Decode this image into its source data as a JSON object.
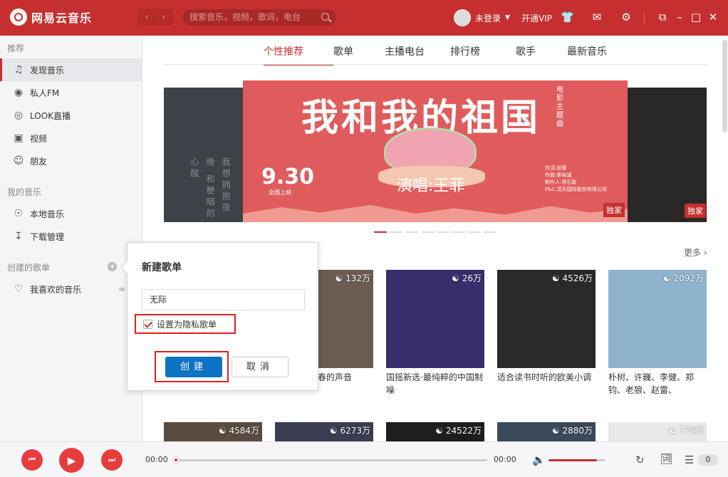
{
  "app": {
    "name": "网易云音乐",
    "search_placeholder": "搜索音乐，视频，歌词，电台",
    "user_label": "未登录",
    "vip_label": "开通VIP"
  },
  "sidebar": {
    "heading_recommend": "推荐",
    "recommend_items": [
      "发现音乐",
      "私人FM",
      "LOOK直播",
      "视频",
      "朋友"
    ],
    "heading_my_music": "我的音乐",
    "my_music_items": [
      "本地音乐",
      "下载管理"
    ],
    "heading_created": "创建的歌单",
    "playlists": [
      "我喜欢的音乐"
    ]
  },
  "tabs": [
    "个性推荐",
    "歌单",
    "主播电台",
    "排行榜",
    "歌手",
    "最新音乐"
  ],
  "banner": {
    "title": "我和我的祖国",
    "date": "9.30",
    "date_sub": "全国上映",
    "singer": "演唱:王菲",
    "vertical_text": "电影主题曲",
    "credits": [
      "作词:张藜",
      "作曲:秦咏诚",
      "制作人:常石磊",
      "P&C:觅乐国际股份有限公司"
    ],
    "badge": "独家",
    "left_poem": "我想拥抱夜晚 和梗咽的心酸"
  },
  "more_label": "更多",
  "cards_row1": [
    {
      "count": "132万",
      "title": "那些关于青春的声音",
      "color": "#6b5b52"
    },
    {
      "count": "26万",
      "title": "国摇新选·最纯粹的中国制噪",
      "color": "#3a2d6d"
    },
    {
      "count": "4526万",
      "title": "适合读书时听的欧美小调",
      "color": "#2a2a2a"
    },
    {
      "count": "2092万",
      "title": "朴树、许巍、李健、郑钧、老狼、赵雷、",
      "color": "#8fb3cc"
    }
  ],
  "cards_row2": [
    {
      "count": "4584万",
      "color": "#5a4a40"
    },
    {
      "count": "6273万",
      "color": "#3b3d52"
    },
    {
      "count": "24522万",
      "color": "#1e1e1e"
    },
    {
      "count": "2880万",
      "color": "#3a4a5a"
    },
    {
      "count": "779万",
      "color": "#e8e8e8"
    }
  ],
  "dialog": {
    "title": "新建歌单",
    "input_value": "无际",
    "private_label": "设置为隐私歌单",
    "private_checked": true,
    "create_label": "创建",
    "cancel_label": "取消"
  },
  "player": {
    "time_current": "00:00",
    "time_total": "00:00",
    "lyrics_label": "词",
    "queue_count": "0",
    "progress": 0,
    "volume": 0.85
  }
}
